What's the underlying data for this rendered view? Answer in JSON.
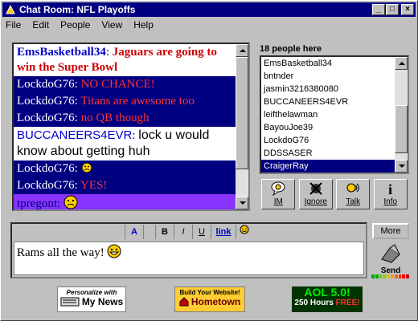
{
  "window": {
    "title": "Chat Room: NFL Playoffs",
    "controls": [
      "_",
      "□",
      "×"
    ]
  },
  "menu": [
    "File",
    "Edit",
    "People",
    "View",
    "Help"
  ],
  "chat": {
    "messages": [
      {
        "name": "EmsBasketball34",
        "sep": ": ",
        "text": "Jaguars are going to win the Super Bowl",
        "bg": "#ffffff",
        "name_color": "#0000cc",
        "text_color": "#cc0000",
        "bold": true,
        "emoji": ""
      },
      {
        "name": "LockdoG76",
        "sep": ": ",
        "text": "NO CHANCE!",
        "bg": "#000080",
        "name_color": "#ffffff",
        "text_color": "#ff3333",
        "bold": false,
        "emoji": ""
      },
      {
        "name": "LockdoG76",
        "sep": ": ",
        "text": "Titans are awesome too",
        "bg": "#000080",
        "name_color": "#ffffff",
        "text_color": "#ff3333",
        "bold": false,
        "emoji": ""
      },
      {
        "name": "LockdoG76",
        "sep": ": ",
        "text": "no QB though",
        "bg": "#000080",
        "name_color": "#ffffff",
        "text_color": "#ff3333",
        "bold": false,
        "emoji": ""
      },
      {
        "name": "BUCCANEERS4EVR",
        "sep": ": ",
        "text": "lock u would know about getting huh",
        "bg": "#ffffff",
        "name_color": "#0000cc",
        "text_color": "#000000",
        "bold": false,
        "sans": true,
        "emoji": ""
      },
      {
        "name": "LockdoG76",
        "sep": ": ",
        "text": "",
        "bg": "#000080",
        "name_color": "#ffffff",
        "text_color": "#ff3333",
        "bold": false,
        "emoji": "frown-small"
      },
      {
        "name": "LockdoG76",
        "sep": ": ",
        "text": "YES!",
        "bg": "#000080",
        "name_color": "#ffffff",
        "text_color": "#ff3333",
        "bold": false,
        "emoji": ""
      },
      {
        "name": "tpregont",
        "sep": ": ",
        "text": "",
        "bg": "#8833ff",
        "name_color": "#000080",
        "text_color": "#000000",
        "bold": false,
        "emoji": "frown-big"
      }
    ]
  },
  "people": {
    "header": "18 people here",
    "list": [
      "EmsBasketball34",
      "bntnder",
      "jasmin3216380080",
      "BUCCANEERS4EVR",
      "leifthelawman",
      "BayouJoe39",
      "LockdoG76",
      "DDSSASER",
      "CraigerRay"
    ],
    "selected": "CraigerRay"
  },
  "actions": [
    {
      "label": "IM",
      "icon": "im-icon"
    },
    {
      "label": "Ignore",
      "icon": "ignore-icon"
    },
    {
      "label": "Talk",
      "icon": "talk-icon"
    },
    {
      "label": "Info",
      "icon": "info-icon"
    }
  ],
  "format_toolbar": {
    "color_a": "A",
    "bold": "B",
    "italic": "I",
    "underline": "U",
    "link": "link"
  },
  "compose": {
    "text": "Rams all the way!",
    "emoji": "grin"
  },
  "buttons": {
    "more": "More",
    "send": "Send"
  },
  "ads": {
    "ad1": {
      "line1": "Personalize with",
      "line2": "My News"
    },
    "ad2": {
      "line1": "Build Your Website!",
      "line2": "Hometown"
    },
    "ad3": {
      "line1": "AOL 5.0!",
      "line2": "250 Hours",
      "line3": "FREE!"
    }
  },
  "colors": {
    "title_bg": "#000080",
    "selected_bg": "#000080",
    "window_bg": "#c0c0c0"
  }
}
